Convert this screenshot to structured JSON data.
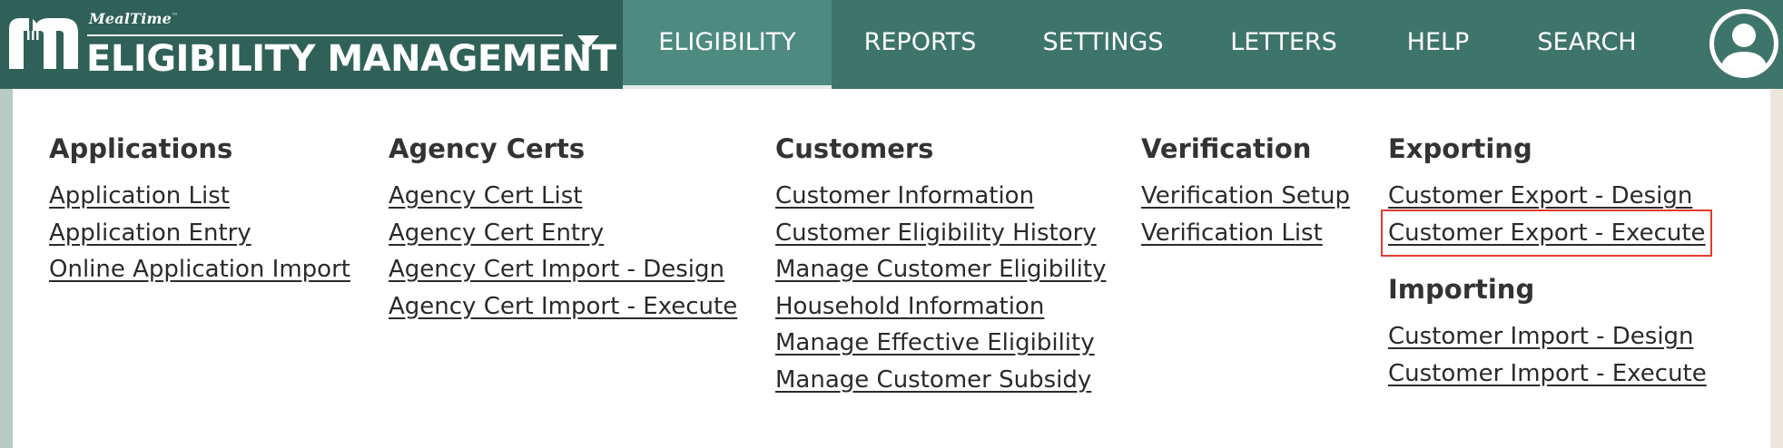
{
  "header": {
    "brand_small": "MealTime",
    "brand_title": "ELIGIBILITY MANAGEMENT",
    "nav_tabs": [
      {
        "label": "ELIGIBILITY",
        "active": true
      },
      {
        "label": "REPORTS",
        "active": false
      },
      {
        "label": "SETTINGS",
        "active": false
      },
      {
        "label": "LETTERS",
        "active": false
      },
      {
        "label": "HELP",
        "active": false
      },
      {
        "label": "SEARCH",
        "active": false
      }
    ],
    "icons": {
      "logo": "mealtime-logo-icon",
      "caret": "chevron-down-icon",
      "avatar": "user-avatar-icon"
    }
  },
  "menu": {
    "applications": {
      "heading": "Applications",
      "items": [
        "Application List",
        "Application Entry",
        "Online Application Import"
      ]
    },
    "agency_certs": {
      "heading": "Agency Certs",
      "items": [
        "Agency Cert List",
        "Agency Cert Entry",
        "Agency Cert Import - Design",
        "Agency Cert Import - Execute"
      ]
    },
    "customers": {
      "heading": "Customers",
      "items": [
        "Customer Information",
        "Customer Eligibility History",
        "Manage Customer Eligibility",
        "Household Information",
        "Manage Effective Eligibility",
        "Manage Customer Subsidy"
      ]
    },
    "verification": {
      "heading": "Verification",
      "items": [
        "Verification Setup",
        "Verification List"
      ]
    },
    "exporting": {
      "heading": "Exporting",
      "items": [
        "Customer Export - Design",
        "Customer Export - Execute"
      ]
    },
    "importing": {
      "heading": "Importing",
      "items": [
        "Customer Import - Design",
        "Customer Import - Execute"
      ]
    }
  },
  "colors": {
    "nav_bg": "#3e756b",
    "brand_bg": "#2f6158",
    "active_tab_bg": "#4d8b80",
    "highlight_outline": "#e23b2e"
  }
}
